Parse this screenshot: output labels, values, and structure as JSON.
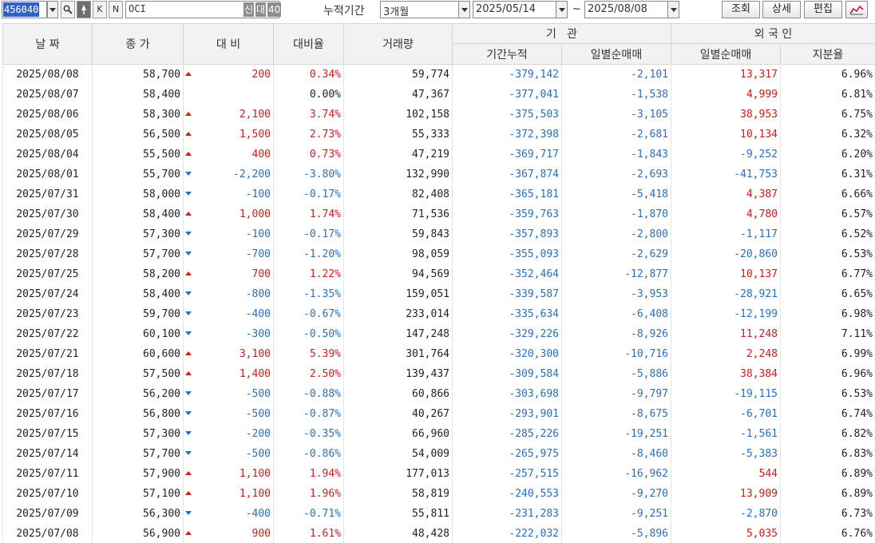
{
  "toolbar": {
    "code": "456040",
    "name": "OCI",
    "tag_new": "신",
    "tag_loan": "대",
    "tag_40": "40",
    "icon_k": "K",
    "icon_n": "N",
    "period_label": "누적기간",
    "period_value": "3개월",
    "date_from": "2025/05/14",
    "tilde": "~",
    "date_to": "2025/08/08",
    "btn_query": "조회",
    "btn_detail": "상세",
    "btn_edit": "편집"
  },
  "headers": {
    "date": "날 짜",
    "close": "종 가",
    "change": "대 비",
    "rate": "대비율",
    "volume": "거래량",
    "inst": "기   관",
    "inst_cum": "기간누적",
    "inst_daily": "일별순매매",
    "foreign": "외 국 인",
    "foreign_daily": "일별순매매",
    "foreign_share": "지분율"
  },
  "colors": {
    "up": "#d41a1a",
    "down": "#2a6ec4",
    "header_bg": "#f2f2f2"
  },
  "rows": [
    {
      "date": "2025/08/08",
      "close": "58,700",
      "dir": "up",
      "change": "200",
      "rate": "0.34%",
      "volume": "59,774",
      "inst_cum": "-379,142",
      "inst_daily": "-2,101",
      "for_daily": "13,317",
      "share": "6.96%"
    },
    {
      "date": "2025/08/07",
      "close": "58,400",
      "dir": "flat",
      "change": "",
      "rate": "0.00%",
      "volume": "47,367",
      "inst_cum": "-377,041",
      "inst_daily": "-1,538",
      "for_daily": "4,999",
      "share": "6.81%"
    },
    {
      "date": "2025/08/06",
      "close": "58,300",
      "dir": "up",
      "change": "2,100",
      "rate": "3.74%",
      "volume": "102,158",
      "inst_cum": "-375,503",
      "inst_daily": "-3,105",
      "for_daily": "38,953",
      "share": "6.75%"
    },
    {
      "date": "2025/08/05",
      "close": "56,500",
      "dir": "up",
      "change": "1,500",
      "rate": "2.73%",
      "volume": "55,333",
      "inst_cum": "-372,398",
      "inst_daily": "-2,681",
      "for_daily": "10,134",
      "share": "6.32%"
    },
    {
      "date": "2025/08/04",
      "close": "55,500",
      "dir": "up",
      "change": "400",
      "rate": "0.73%",
      "volume": "47,219",
      "inst_cum": "-369,717",
      "inst_daily": "-1,843",
      "for_daily": "-9,252",
      "share": "6.20%"
    },
    {
      "date": "2025/08/01",
      "close": "55,700",
      "dir": "down",
      "change": "-2,200",
      "rate": "-3.80%",
      "volume": "132,990",
      "inst_cum": "-367,874",
      "inst_daily": "-2,693",
      "for_daily": "-41,753",
      "share": "6.31%"
    },
    {
      "date": "2025/07/31",
      "close": "58,000",
      "dir": "down",
      "change": "-100",
      "rate": "-0.17%",
      "volume": "82,408",
      "inst_cum": "-365,181",
      "inst_daily": "-5,418",
      "for_daily": "4,387",
      "share": "6.66%"
    },
    {
      "date": "2025/07/30",
      "close": "58,400",
      "dir": "up",
      "change": "1,000",
      "rate": "1.74%",
      "volume": "71,536",
      "inst_cum": "-359,763",
      "inst_daily": "-1,870",
      "for_daily": "4,780",
      "share": "6.57%"
    },
    {
      "date": "2025/07/29",
      "close": "57,300",
      "dir": "down",
      "change": "-100",
      "rate": "-0.17%",
      "volume": "59,843",
      "inst_cum": "-357,893",
      "inst_daily": "-2,800",
      "for_daily": "-1,117",
      "share": "6.52%"
    },
    {
      "date": "2025/07/28",
      "close": "57,700",
      "dir": "down",
      "change": "-700",
      "rate": "-1.20%",
      "volume": "98,059",
      "inst_cum": "-355,093",
      "inst_daily": "-2,629",
      "for_daily": "-20,860",
      "share": "6.53%"
    },
    {
      "date": "2025/07/25",
      "close": "58,200",
      "dir": "up",
      "change": "700",
      "rate": "1.22%",
      "volume": "94,569",
      "inst_cum": "-352,464",
      "inst_daily": "-12,877",
      "for_daily": "10,137",
      "share": "6.77%"
    },
    {
      "date": "2025/07/24",
      "close": "58,400",
      "dir": "down",
      "change": "-800",
      "rate": "-1.35%",
      "volume": "159,051",
      "inst_cum": "-339,587",
      "inst_daily": "-3,953",
      "for_daily": "-28,921",
      "share": "6.65%"
    },
    {
      "date": "2025/07/23",
      "close": "59,700",
      "dir": "down",
      "change": "-400",
      "rate": "-0.67%",
      "volume": "233,014",
      "inst_cum": "-335,634",
      "inst_daily": "-6,408",
      "for_daily": "-12,199",
      "share": "6.98%"
    },
    {
      "date": "2025/07/22",
      "close": "60,100",
      "dir": "down",
      "change": "-300",
      "rate": "-0.50%",
      "volume": "147,248",
      "inst_cum": "-329,226",
      "inst_daily": "-8,926",
      "for_daily": "11,248",
      "share": "7.11%"
    },
    {
      "date": "2025/07/21",
      "close": "60,600",
      "dir": "up",
      "change": "3,100",
      "rate": "5.39%",
      "volume": "301,764",
      "inst_cum": "-320,300",
      "inst_daily": "-10,716",
      "for_daily": "2,248",
      "share": "6.99%"
    },
    {
      "date": "2025/07/18",
      "close": "57,500",
      "dir": "up",
      "change": "1,400",
      "rate": "2.50%",
      "volume": "139,437",
      "inst_cum": "-309,584",
      "inst_daily": "-5,886",
      "for_daily": "38,384",
      "share": "6.96%"
    },
    {
      "date": "2025/07/17",
      "close": "56,200",
      "dir": "down",
      "change": "-500",
      "rate": "-0.88%",
      "volume": "60,866",
      "inst_cum": "-303,698",
      "inst_daily": "-9,797",
      "for_daily": "-19,115",
      "share": "6.53%"
    },
    {
      "date": "2025/07/16",
      "close": "56,800",
      "dir": "down",
      "change": "-500",
      "rate": "-0.87%",
      "volume": "40,267",
      "inst_cum": "-293,901",
      "inst_daily": "-8,675",
      "for_daily": "-6,701",
      "share": "6.74%"
    },
    {
      "date": "2025/07/15",
      "close": "57,300",
      "dir": "down",
      "change": "-200",
      "rate": "-0.35%",
      "volume": "66,960",
      "inst_cum": "-285,226",
      "inst_daily": "-19,251",
      "for_daily": "-1,561",
      "share": "6.82%"
    },
    {
      "date": "2025/07/14",
      "close": "57,700",
      "dir": "down",
      "change": "-500",
      "rate": "-0.86%",
      "volume": "54,009",
      "inst_cum": "-265,975",
      "inst_daily": "-8,460",
      "for_daily": "-5,383",
      "share": "6.83%"
    },
    {
      "date": "2025/07/11",
      "close": "57,900",
      "dir": "up",
      "change": "1,100",
      "rate": "1.94%",
      "volume": "177,013",
      "inst_cum": "-257,515",
      "inst_daily": "-16,962",
      "for_daily": "544",
      "share": "6.89%"
    },
    {
      "date": "2025/07/10",
      "close": "57,100",
      "dir": "up",
      "change": "1,100",
      "rate": "1.96%",
      "volume": "58,819",
      "inst_cum": "-240,553",
      "inst_daily": "-9,270",
      "for_daily": "13,909",
      "share": "6.89%"
    },
    {
      "date": "2025/07/09",
      "close": "56,300",
      "dir": "down",
      "change": "-400",
      "rate": "-0.71%",
      "volume": "55,811",
      "inst_cum": "-231,283",
      "inst_daily": "-9,251",
      "for_daily": "-2,870",
      "share": "6.73%"
    },
    {
      "date": "2025/07/08",
      "close": "56,900",
      "dir": "up",
      "change": "900",
      "rate": "1.61%",
      "volume": "48,428",
      "inst_cum": "-222,032",
      "inst_daily": "-5,896",
      "for_daily": "5,035",
      "share": "6.76%"
    }
  ]
}
